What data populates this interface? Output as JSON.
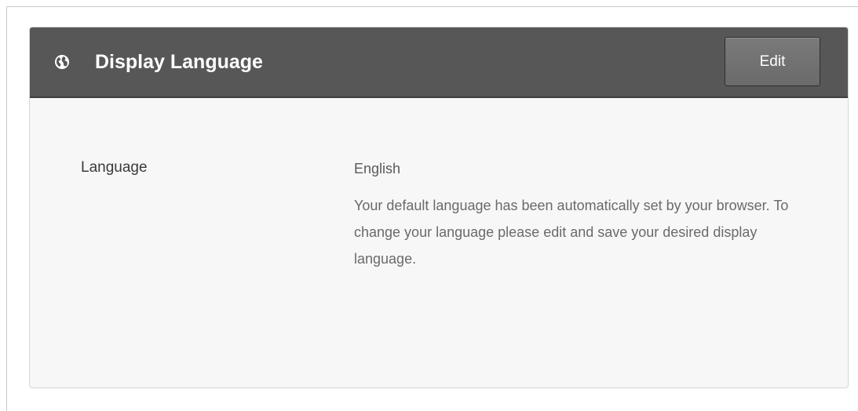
{
  "panel": {
    "title": "Display Language",
    "icon": "globe-icon",
    "edit_label": "Edit",
    "header_color": "#575757"
  },
  "language_field": {
    "label": "Language",
    "value": "English",
    "help_text": "Your default language has been automatically set by your browser. To change your language please edit and save your desired display language."
  }
}
